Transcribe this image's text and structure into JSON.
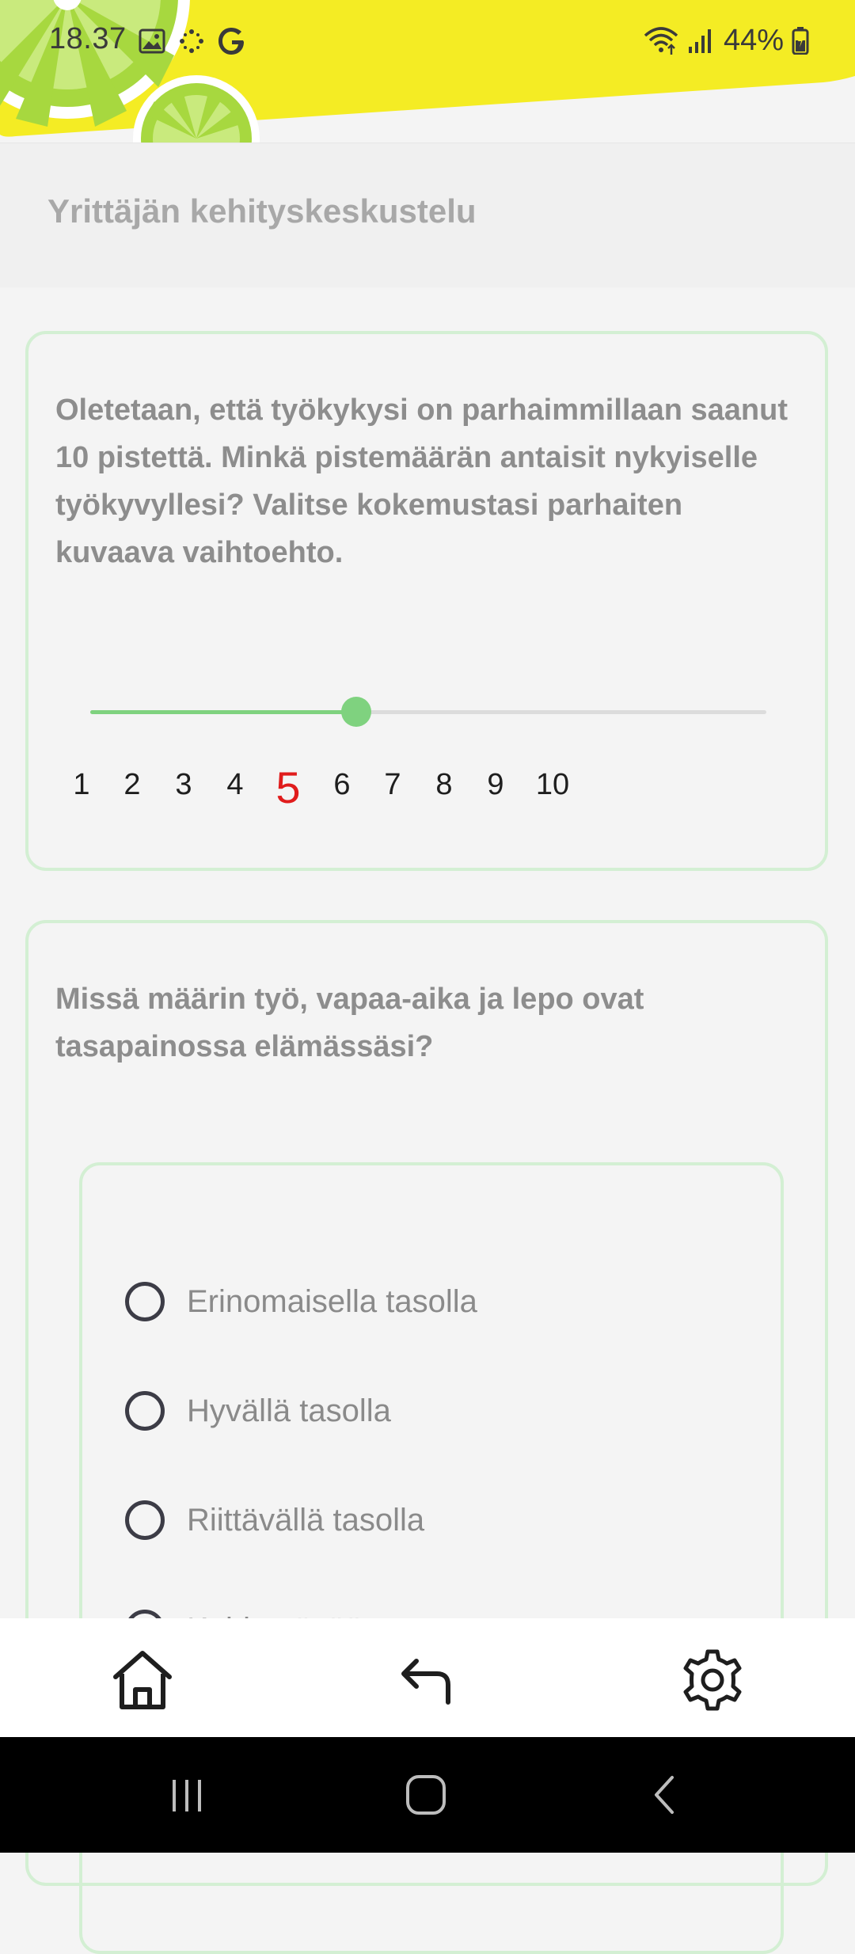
{
  "status_bar": {
    "time": "18.37",
    "battery": "44%",
    "icons": [
      "image-icon",
      "dots-icon",
      "google-icon",
      "wifi-icon",
      "signal-icon",
      "battery-icon"
    ]
  },
  "header": {
    "title": "Yrittäjän kehityskeskustelu"
  },
  "question1": {
    "text": "Oletetaan, että työkykysi on parhaimmillaan saanut 10 pistettä. Minkä pistemäärän antaisit nykyiselle työkyvyllesi? Valitse kokemustasi parhaiten kuvaava vaihtoehto.",
    "scale": [
      "1",
      "2",
      "3",
      "4",
      "5",
      "6",
      "7",
      "8",
      "9",
      "10"
    ],
    "selected_value": 5,
    "min": 1,
    "max": 10
  },
  "question2": {
    "text": "Missä määrin työ, vapaa-aika ja lepo ovat tasapainossa elämässäsi?",
    "options": [
      "Erinomaisella tasolla",
      "Hyvällä tasolla",
      "Riittävällä tasolla",
      "Kehitettävää on"
    ]
  },
  "bottom_nav": {
    "items": [
      "home-icon",
      "back-arrow-icon",
      "settings-icon"
    ]
  },
  "system_nav": {
    "items": [
      "recents-icon",
      "home-circle-icon",
      "back-chevron-icon"
    ]
  },
  "colors": {
    "accent_green": "#7fd27f",
    "card_border": "#d3efd3",
    "selected_red": "#e01c1c",
    "banner_yellow": "#f4ec24"
  }
}
